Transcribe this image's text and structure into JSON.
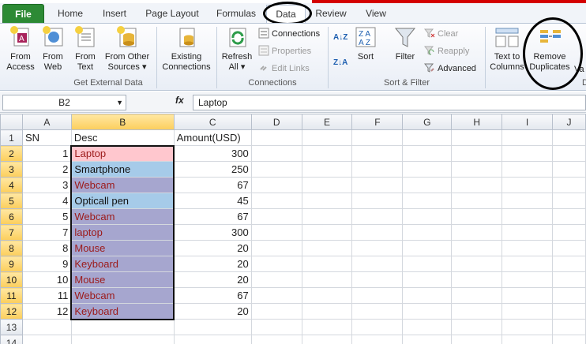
{
  "ribbon_tabs": [
    "File",
    "Home",
    "Insert",
    "Page Layout",
    "Formulas",
    "Data",
    "Review",
    "View"
  ],
  "groups": {
    "external": {
      "label": "Get External Data",
      "from_access": [
        "From",
        "Access"
      ],
      "from_web": [
        "From",
        "Web"
      ],
      "from_text": [
        "From",
        "Text"
      ],
      "from_other": [
        "From Other",
        "Sources ▾"
      ],
      "existing": [
        "Existing",
        "Connections"
      ]
    },
    "connections": {
      "label": "Connections",
      "refresh": [
        "Refresh",
        "All ▾"
      ],
      "connections": "Connections",
      "properties": "Properties",
      "edit_links": "Edit Links"
    },
    "sortfilter": {
      "label": "Sort & Filter",
      "sort": "Sort",
      "filter": "Filter",
      "clear": "Clear",
      "reapply": "Reapply",
      "advanced": "Advanced"
    },
    "datatools": {
      "text_to_columns": [
        "Text to",
        "Columns"
      ],
      "remove_duplicates": [
        "Remove",
        "Duplicates"
      ],
      "partial_label": "D",
      "partial_next": "Va"
    }
  },
  "formula_bar": {
    "name_box": "B2",
    "fx": "fx",
    "value": "Laptop"
  },
  "columns": [
    "A",
    "B",
    "C",
    "D",
    "E",
    "F",
    "G",
    "H",
    "I",
    "J"
  ],
  "headers": {
    "a": "SN",
    "b": "Desc",
    "c": "Amount(USD)"
  },
  "rows": [
    {
      "sn": "1",
      "desc": "Laptop",
      "amt": "300"
    },
    {
      "sn": "2",
      "desc": "Smartphone",
      "amt": "250"
    },
    {
      "sn": "3",
      "desc": "Webcam",
      "amt": "67"
    },
    {
      "sn": "4",
      "desc": "Opticall pen",
      "amt": "45"
    },
    {
      "sn": "5",
      "desc": "Webcam",
      "amt": "67"
    },
    {
      "sn": "7",
      "desc": "laptop",
      "amt": "300"
    },
    {
      "sn": "8",
      "desc": "Mouse",
      "amt": "20"
    },
    {
      "sn": "9",
      "desc": "Keyboard",
      "amt": "20"
    },
    {
      "sn": "10",
      "desc": "Mouse",
      "amt": "20"
    },
    {
      "sn": "11",
      "desc": "Webcam",
      "amt": "67"
    },
    {
      "sn": "12",
      "desc": "Keyboard",
      "amt": "20"
    }
  ],
  "row_numbers": [
    "1",
    "2",
    "3",
    "4",
    "5",
    "6",
    "7",
    "8",
    "9",
    "10",
    "11",
    "12",
    "13",
    "14"
  ],
  "colors": {
    "file_tab": "#2d8a35",
    "duplicate_fill": "#a6a6cf",
    "pink_fill": "#ffc7ce",
    "blue_fill": "#a6cbe9",
    "duplicate_text": "#9c1a1a"
  }
}
